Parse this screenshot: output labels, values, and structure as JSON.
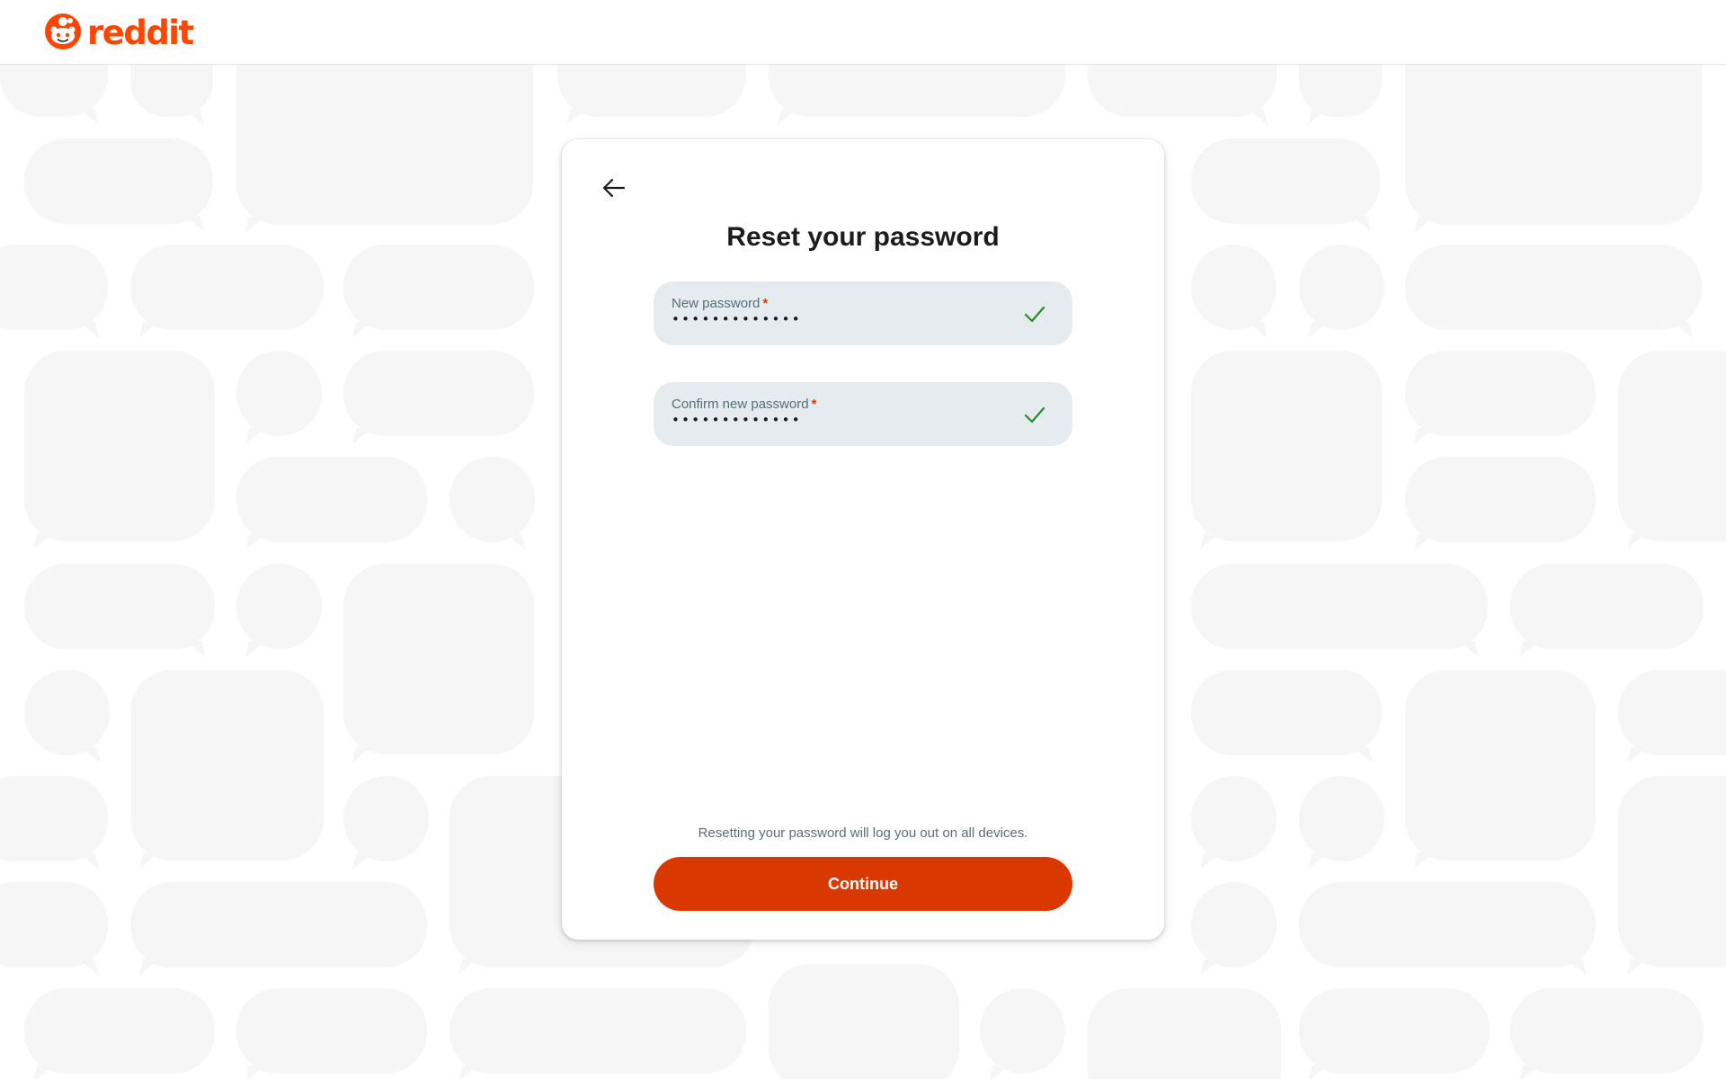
{
  "header": {
    "logo_text": "reddit",
    "logo_icon": "reddit-snoo-icon",
    "brand_color": "#ff4500"
  },
  "card": {
    "back_icon": "arrow-left-icon",
    "title": "Reset your password",
    "fields": [
      {
        "label": "New password",
        "required_mark": "*",
        "value": "•••••••••••••",
        "status_icon": "checkmark-icon",
        "status_color": "#2a8c2a"
      },
      {
        "label": "Confirm new password",
        "required_mark": "*",
        "value": "•••••••••••••",
        "status_icon": "checkmark-icon",
        "status_color": "#2a8c2a"
      }
    ],
    "notice": "Resetting your password will log you out on all devices.",
    "continue_label": "Continue",
    "continue_color": "#d93900"
  }
}
